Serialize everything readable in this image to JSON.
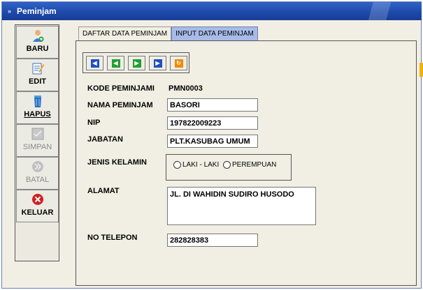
{
  "window": {
    "title": "Peminjam"
  },
  "tabs": [
    {
      "label": "DAFTAR DATA PEMINJAM",
      "active": false
    },
    {
      "label": "INPUT DATA PEMINJAM",
      "active": true
    }
  ],
  "sidebar": [
    {
      "label": "BARU",
      "icon": "user-add-icon",
      "enabled": true
    },
    {
      "label": "EDIT",
      "icon": "edit-icon",
      "enabled": true
    },
    {
      "label": "HAPUS",
      "icon": "trash-icon",
      "enabled": true
    },
    {
      "label": "SIMPAN",
      "icon": "save-icon",
      "enabled": false
    },
    {
      "label": "BATAL",
      "icon": "cancel-icon",
      "enabled": false
    },
    {
      "label": "KELUAR",
      "icon": "exit-icon",
      "enabled": true
    }
  ],
  "nav": [
    {
      "icon": "first-record-icon",
      "color": "#1f4fc0"
    },
    {
      "icon": "prev-record-icon",
      "color": "#20a030"
    },
    {
      "icon": "next-record-icon",
      "color": "#20a030"
    },
    {
      "icon": "last-record-icon",
      "color": "#1f4fc0"
    },
    {
      "icon": "refresh-icon",
      "color": "#f08a00"
    }
  ],
  "form": {
    "kode_label": "KODE PEMINJAMI",
    "kode_value": "PMN0003",
    "nama_label": "NAMA PEMINJAM",
    "nama_value": "BASORI",
    "nip_label": "NIP",
    "nip_value": "197822009223",
    "jabatan_label": "JABATAN",
    "jabatan_value": "PLT.KASUBAG UMUM",
    "jenis_label": "JENIS KELAMIN",
    "jenis_option1": "LAKI - LAKI",
    "jenis_option2": "PEREMPUAN",
    "alamat_label": "ALAMAT",
    "alamat_value": "JL. DI WAHIDIN SUDIRO HUSODO",
    "telepon_label": "NO TELEPON",
    "telepon_value": "282828383"
  },
  "colors": {
    "title_bar": "#1d48a8",
    "active_tab": "#a8bbe8",
    "keluar_icon": "#d02020"
  }
}
